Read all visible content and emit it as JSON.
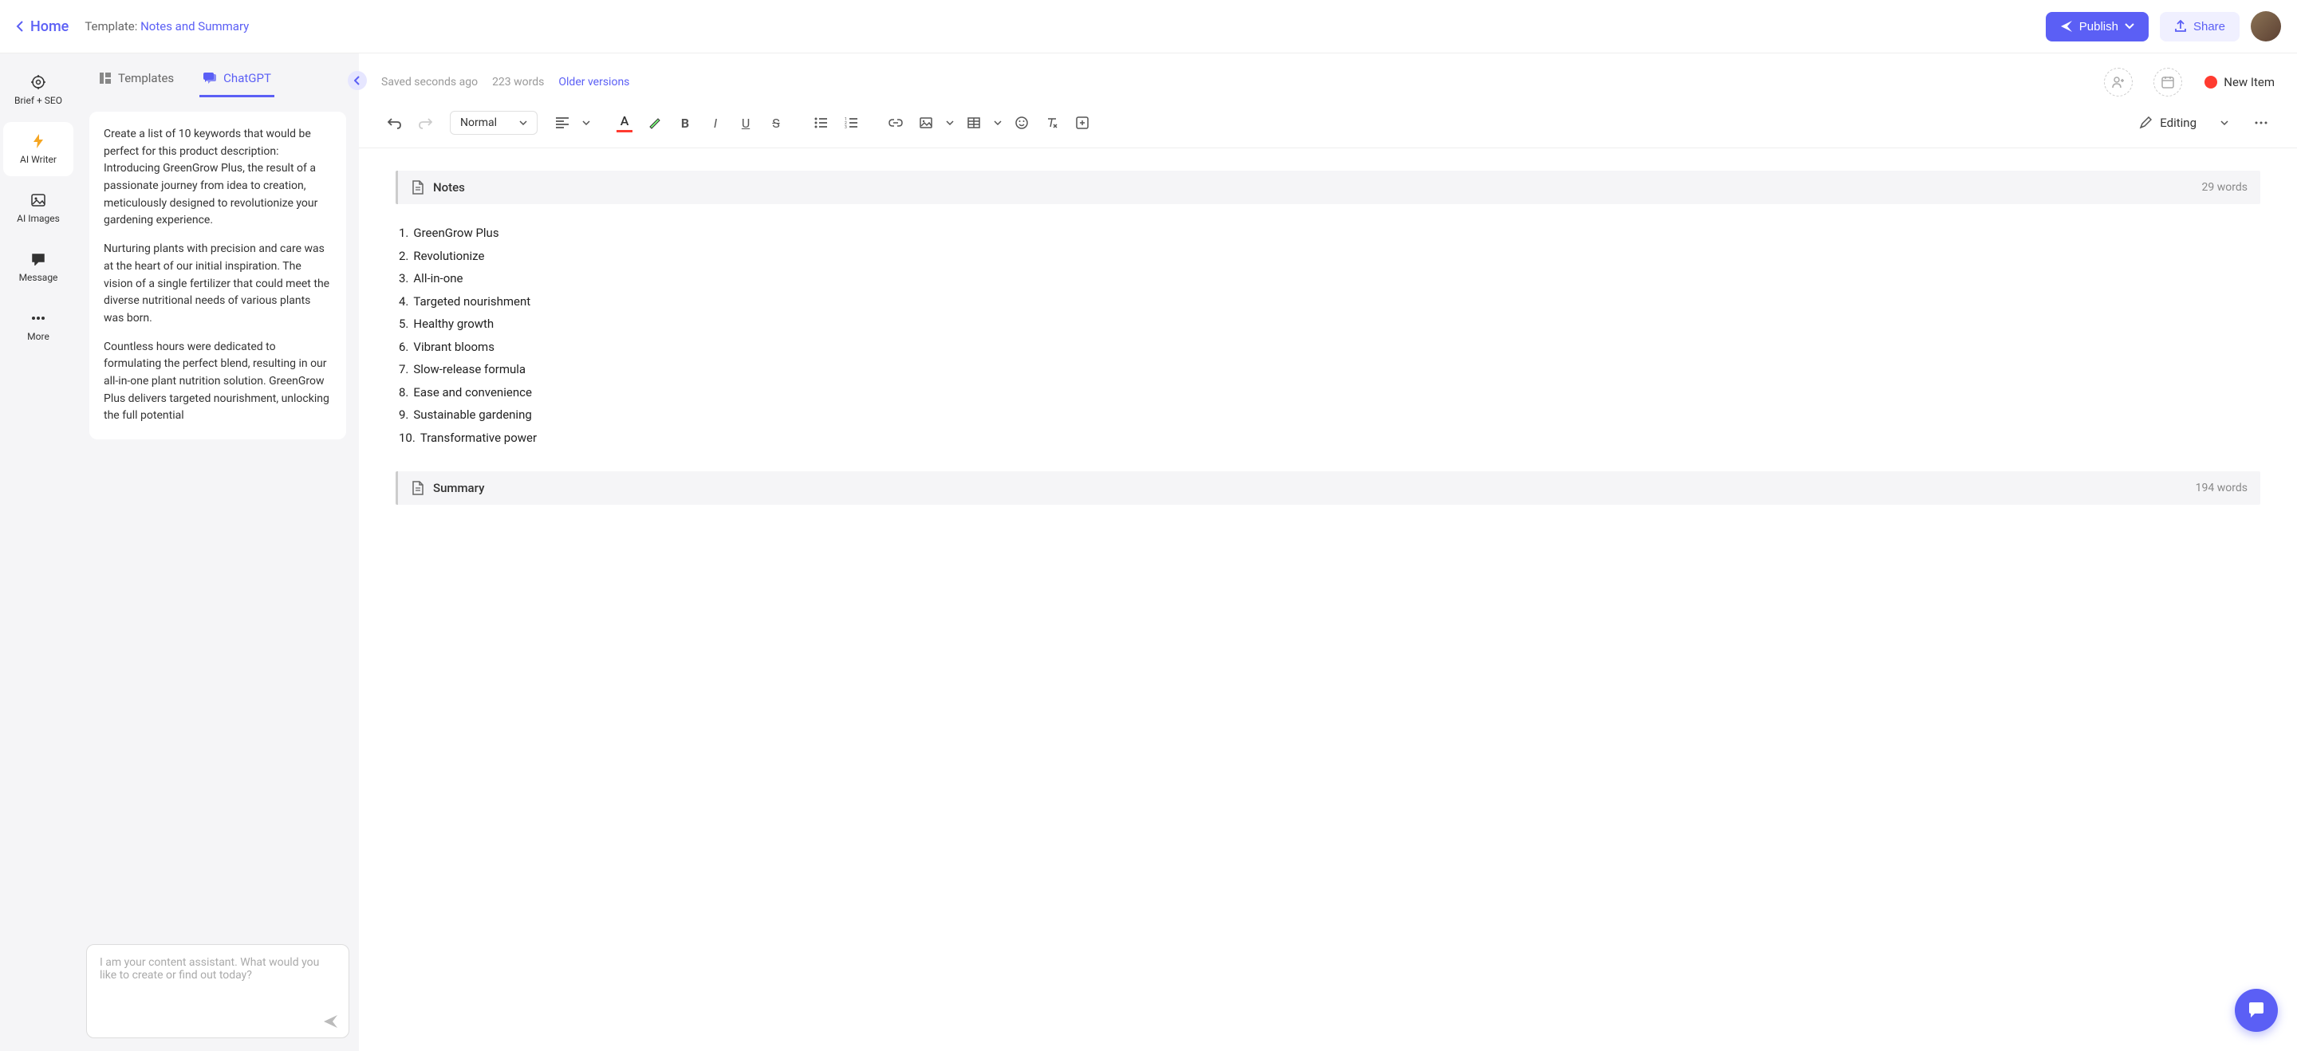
{
  "topbar": {
    "home": "Home",
    "template_label": "Template: ",
    "template_name": "Notes and Summary",
    "publish": "Publish",
    "share": "Share"
  },
  "rail": {
    "items": [
      {
        "label": "Brief + SEO",
        "icon": "target-icon"
      },
      {
        "label": "AI Writer",
        "icon": "bolt-icon"
      },
      {
        "label": "AI Images",
        "icon": "image-icon"
      },
      {
        "label": "Message",
        "icon": "chat-icon"
      },
      {
        "label": "More",
        "icon": "more-icon"
      }
    ]
  },
  "panel": {
    "tabs": {
      "templates": "Templates",
      "chatgpt": "ChatGPT"
    },
    "msg_p1": "Create a list of 10 keywords that would be perfect for this product description: Introducing GreenGrow Plus, the result of a passionate journey from idea to creation, meticulously designed to revolutionize your gardening experience.",
    "msg_p2": "Nurturing plants with precision and care was at the heart of our initial inspiration. The vision of a single fertilizer that could meet the diverse nutritional needs of various plants was born.",
    "msg_p3": "Countless hours were dedicated to formulating the perfect blend, resulting in our all-in-one plant nutrition solution. GreenGrow Plus delivers targeted nourishment, unlocking the full potential",
    "input_placeholder": "I am your content assistant. What would you like to create or find out today?"
  },
  "editor_header": {
    "saved": "Saved seconds ago",
    "word_count": "223 words",
    "older": "Older versions",
    "new_item": "New Item"
  },
  "toolbar": {
    "style": "Normal",
    "mode": "Editing"
  },
  "document": {
    "notes": {
      "title": "Notes",
      "count": "29 words",
      "items": [
        "GreenGrow Plus",
        "Revolutionize",
        "All-in-one",
        "Targeted nourishment",
        "Healthy growth",
        "Vibrant blooms",
        "Slow-release formula",
        "Ease and convenience",
        "Sustainable gardening",
        "Transformative power"
      ]
    },
    "summary": {
      "title": "Summary",
      "count": "194 words"
    }
  }
}
